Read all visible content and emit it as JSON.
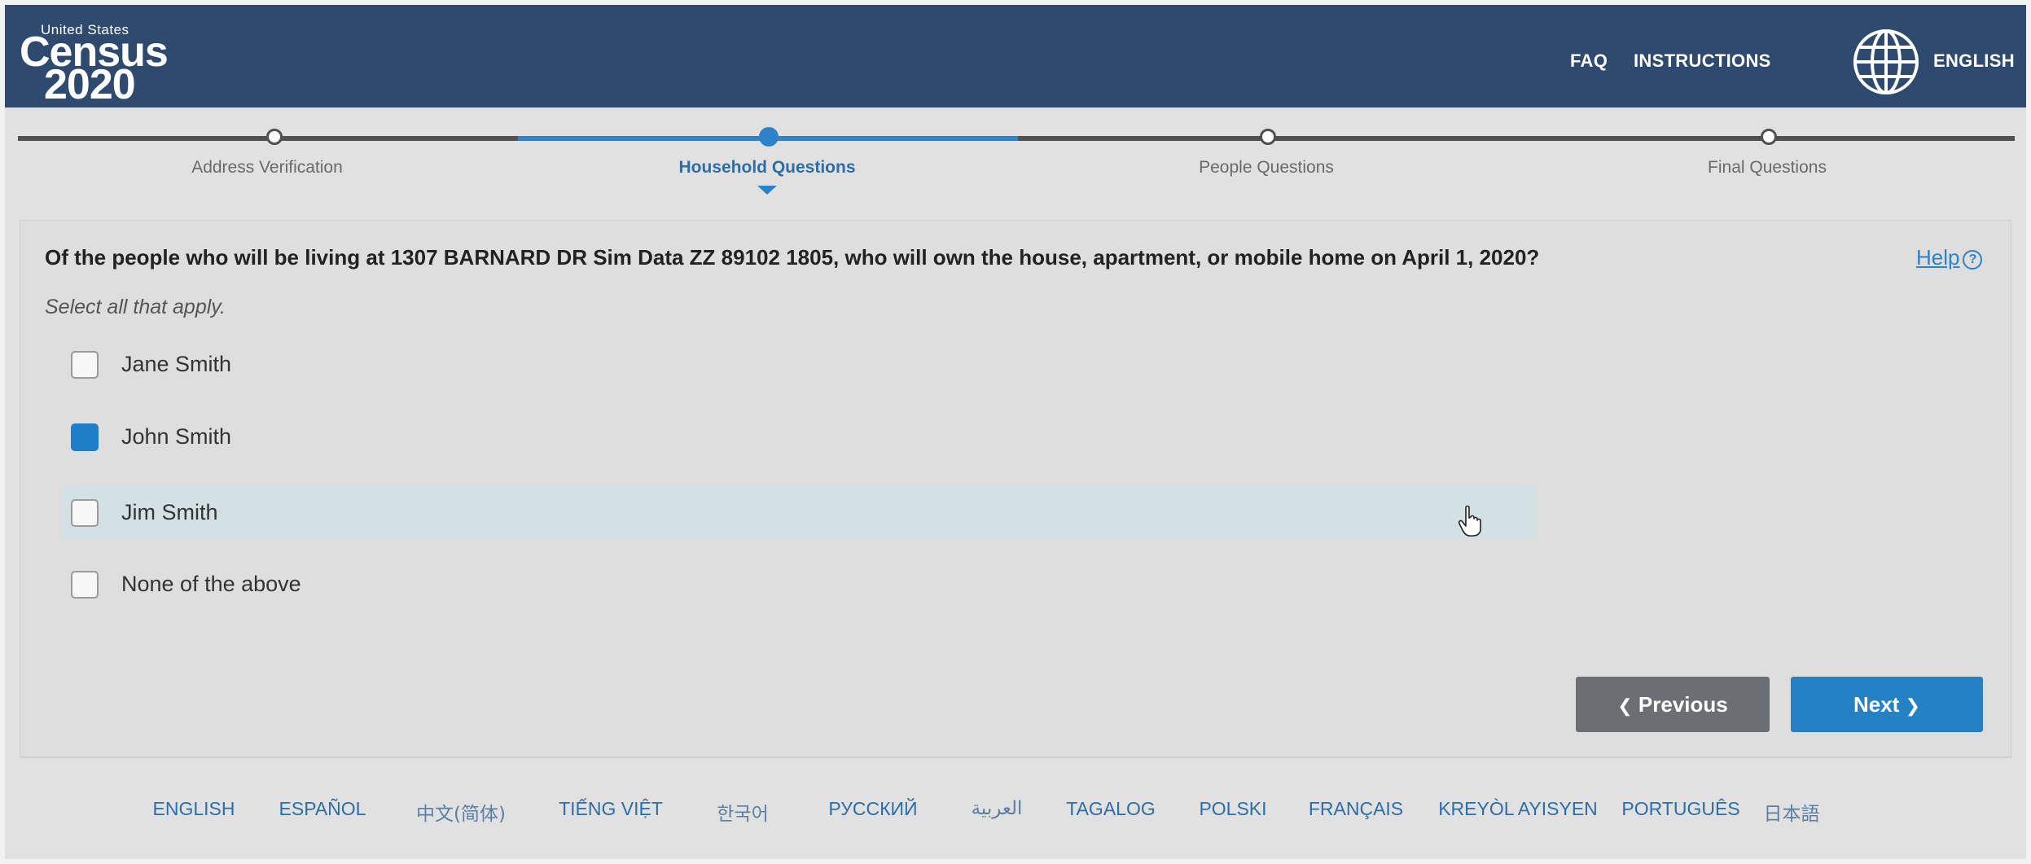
{
  "header": {
    "logo": {
      "line1": "United States",
      "line2": "Census",
      "line3": "2020"
    },
    "nav": {
      "faq": "FAQ",
      "instructions": "INSTRUCTIONS",
      "language": "ENGLISH"
    },
    "icons": {
      "globe": "globe-icon"
    }
  },
  "progress": {
    "steps": [
      {
        "label": "Address Verification",
        "state": "complete"
      },
      {
        "label": "Household Questions",
        "state": "current"
      },
      {
        "label": "People Questions",
        "state": "upcoming"
      },
      {
        "label": "Final Questions",
        "state": "upcoming"
      }
    ],
    "active_color": "#2d83c8"
  },
  "question": {
    "text": "Of the people who will be living at 1307 BARNARD DR Sim Data ZZ 89102 1805, who will own the house, apartment, or mobile home on April 1, 2020?",
    "help": "Help",
    "instruction": "Select all that apply.",
    "options": [
      {
        "label": "Jane Smith",
        "checked": false
      },
      {
        "label": "John Smith",
        "checked": true
      },
      {
        "label": "Jim Smith",
        "checked": false,
        "hovered": true
      },
      {
        "label": "None of the above",
        "checked": false
      }
    ]
  },
  "buttons": {
    "previous": "Previous",
    "next": "Next"
  },
  "languages": [
    "ENGLISH",
    "ESPAÑOL",
    "中文(简体)",
    "TIẾNG VIỆT",
    "한국어",
    "РУССКИЙ",
    "العربية",
    "TAGALOG",
    "POLSKI",
    "FRANÇAIS",
    "KREYÒL AYISYEN",
    "PORTUGUÊS",
    "日本語"
  ],
  "colors": {
    "header_bg": "#2e4a6e",
    "primary": "#2481c4",
    "secondary": "#6b6e72"
  }
}
